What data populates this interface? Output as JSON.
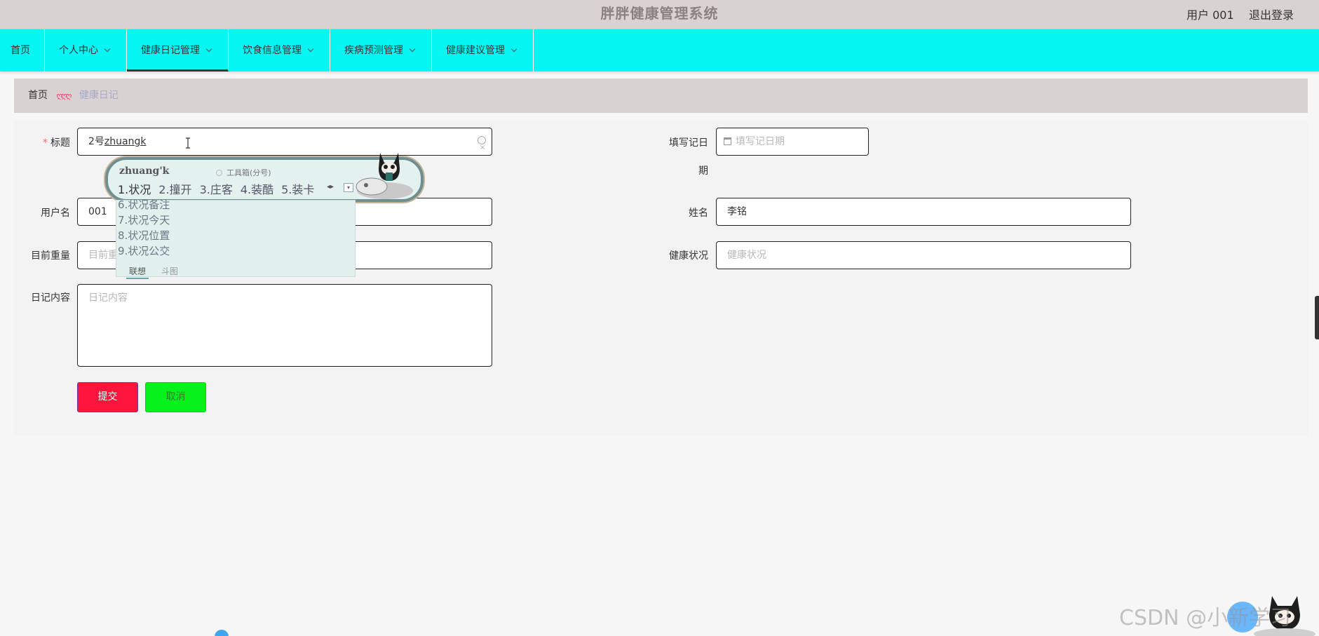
{
  "header": {
    "title": "胖胖健康管理系统",
    "user_label": "用户 001",
    "logout_label": "退出登录"
  },
  "nav": {
    "items": [
      {
        "label": "首页",
        "has_dropdown": false
      },
      {
        "label": "个人中心",
        "has_dropdown": true
      },
      {
        "label": "健康日记管理",
        "has_dropdown": true,
        "active": true
      },
      {
        "label": "饮食信息管理",
        "has_dropdown": true
      },
      {
        "label": "疾病预测管理",
        "has_dropdown": true
      },
      {
        "label": "健康建议管理",
        "has_dropdown": true
      }
    ]
  },
  "breadcrumb": {
    "home": "首页",
    "separator": "ღღღ",
    "current": "健康日记"
  },
  "form": {
    "title": {
      "label": "标题",
      "required_mark": "*",
      "prefix": "2号",
      "composing": "zhuangk"
    },
    "date": {
      "label_line1": "填写记日",
      "label_line2": "期",
      "placeholder": "填写记日期"
    },
    "username": {
      "label": "用户名",
      "value": "001"
    },
    "name": {
      "label": "姓名",
      "value": "李铭"
    },
    "weight": {
      "label": "目前重量",
      "placeholder": "目前重"
    },
    "health": {
      "label": "健康状况",
      "placeholder": "健康状况"
    },
    "content": {
      "label": "日记内容",
      "placeholder": "日记内容"
    },
    "submit_label": "提交",
    "cancel_label": "取消"
  },
  "ime": {
    "pinyin": "zhuang'k",
    "toolbox": "工具箱(分号)",
    "candidates": [
      "1.状况",
      "2.撞开",
      "3.庄客",
      "4.装酷",
      "5.装卡"
    ],
    "more": [
      "6.状况备注",
      "7.状况今天",
      "8.状况位置",
      "9.状况公交"
    ],
    "tab_association": "联想",
    "tab_doutu": "斗图"
  },
  "watermark": "CSDN @小新学习",
  "colors": {
    "nav_bg": "#06f6f3",
    "header_bg": "#d9d2d2",
    "submit_bg": "#ff143c",
    "cancel_bg": "#07f21a",
    "required": "#f56c6c"
  }
}
